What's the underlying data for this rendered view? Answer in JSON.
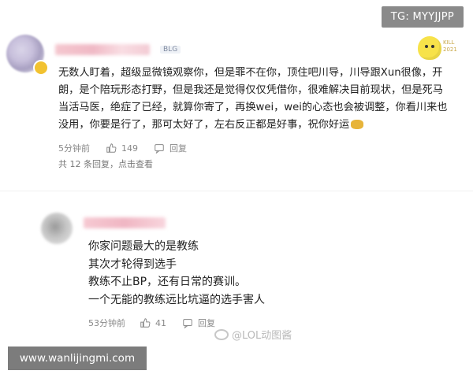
{
  "overlay": {
    "tg_label": "TG: MYYJJPP"
  },
  "comment1": {
    "tag": "BLG",
    "mascot_label": "KILL\n2021",
    "lines": [
      "无数人盯着，超级显微镜观察你，但是罪不在你，顶住吧川导，川导跟Xun很像，开",
      "朗，是个陪玩形态打野，但是我还是觉得仅仅凭借你，很难解决目前现状，但是死马",
      "当活马医，绝症了已经，就算你寄了，再换wei，wei的心态也会被调整，你看川来也",
      "没用，你要是行了，那可太好了，左右反正都是好事，祝你好运"
    ],
    "time": "5分钟前",
    "likes": "149",
    "reply_label": "回复",
    "replies_summary": "共 12 条回复，点击查看"
  },
  "comment2": {
    "lines": [
      "你家问题最大的是教练",
      "其次才轮得到选手",
      "教练不止BP，还有日常的赛训。",
      "一个无能的教练远比坑逼的选手害人"
    ],
    "time": "53分钟前",
    "likes": "41",
    "reply_label": "回复"
  },
  "watermark": {
    "text": "@LOL动图酱"
  },
  "site": {
    "url": "www.wanlijingmi.com"
  },
  "colors": {
    "accent_like": "#888888",
    "badge_bg": "#8a8a8a",
    "site_bg": "#7c7c7c"
  },
  "icons": [
    "thumbs-up-icon",
    "reply-icon",
    "weibo-icon",
    "mascot-icon"
  ]
}
